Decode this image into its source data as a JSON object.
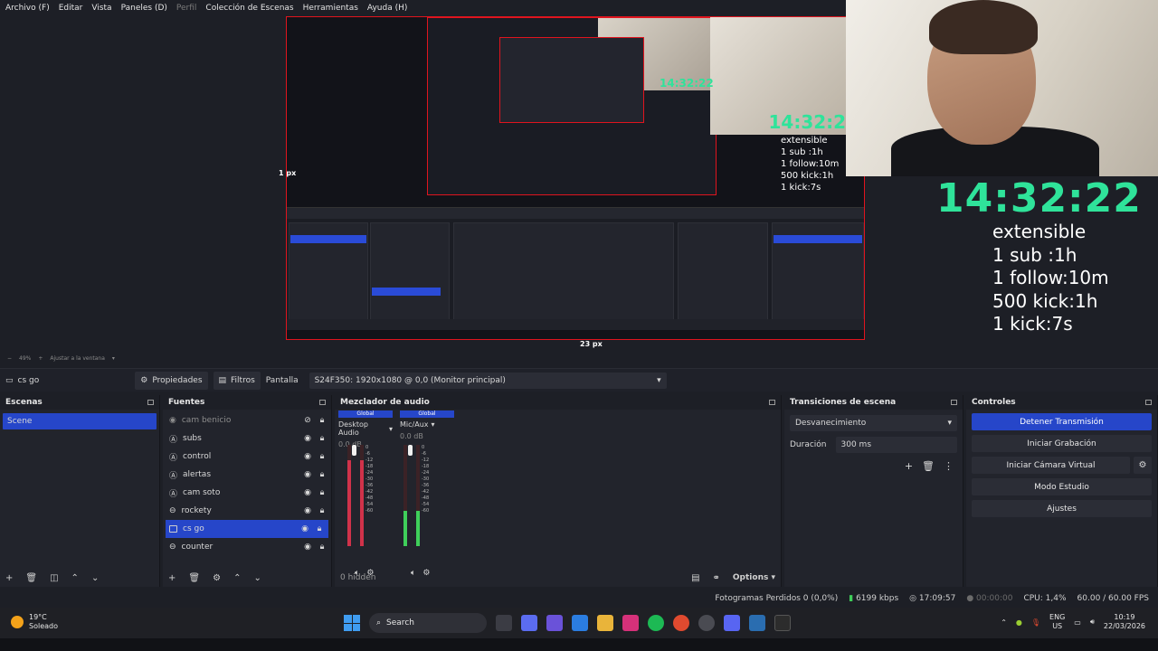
{
  "menu": {
    "items": [
      "Archivo (F)",
      "Editar",
      "Vista",
      "Paneles (D)",
      "Perfil",
      "Colección de Escenas",
      "Herramientas",
      "Ayuda (H)"
    ],
    "disabled_index": 4
  },
  "preview": {
    "px_left": "1 px",
    "px_bottom": "23 px",
    "zoom": "49%",
    "fit_label": "Ajustar a la ventana"
  },
  "overlay": {
    "timer": "14:32:22",
    "rules": [
      "extensible",
      "1 sub :1h",
      "1 follow:10m",
      "500 kick:1h",
      "1 kick:7s"
    ]
  },
  "source_toolbar": {
    "current_source": "cs go",
    "properties": "Propiedades",
    "filters": "Filtros",
    "display_label": "Pantalla",
    "display_value": "S24F350: 1920x1080 @ 0,0 (Monitor principal)"
  },
  "scenes": {
    "title": "Escenas",
    "items": [
      "Scene"
    ]
  },
  "sources": {
    "title": "Fuentes",
    "items": [
      {
        "name": "cam benicio",
        "type": "camera",
        "visible": false
      },
      {
        "name": "subs",
        "type": "text",
        "visible": true
      },
      {
        "name": "control",
        "type": "text",
        "visible": true
      },
      {
        "name": "alertas",
        "type": "text",
        "visible": true
      },
      {
        "name": "cam soto",
        "type": "text",
        "visible": true
      },
      {
        "name": "rockety",
        "type": "link",
        "visible": true
      },
      {
        "name": "cs go",
        "type": "display",
        "visible": true,
        "selected": true
      },
      {
        "name": "counter",
        "type": "link",
        "visible": true
      }
    ]
  },
  "mixer": {
    "title": "Mezclador de audio",
    "global_label": "Global",
    "channels": [
      {
        "name": "Desktop Audio",
        "db": "0.0 dB",
        "level": 0.85,
        "color": "#d0324a"
      },
      {
        "name": "Mic/Aux",
        "db": "0.0 dB",
        "level": 0.35,
        "color": "#3fcf5a"
      }
    ],
    "ticks": [
      "0",
      "-6",
      "-12",
      "-18",
      "-24",
      "-30",
      "-36",
      "-42",
      "-48",
      "-54",
      "-60"
    ],
    "hidden": "0 hidden",
    "options": "Options"
  },
  "transitions": {
    "title": "Transiciones de escena",
    "selected": "Desvanecimiento",
    "duration_label": "Duración",
    "duration_value": "300 ms"
  },
  "controls": {
    "title": "Controles",
    "stop_stream": "Detener Transmisión",
    "start_record": "Iniciar Grabación",
    "virtual_cam": "Iniciar Cámara Virtual",
    "studio_mode": "Modo Estudio",
    "settings": "Ajustes"
  },
  "status": {
    "dropped": "Fotogramas Perdidos 0 (0,0%)",
    "bitrate": "6199 kbps",
    "stream_time": "17:09:57",
    "record_time": "00:00:00",
    "cpu": "CPU: 1,4%",
    "fps": "60.00 / 60.00 FPS"
  },
  "taskbar": {
    "weather_temp": "19°C",
    "weather_desc": "Soleado",
    "search": "Search",
    "lang1": "ENG",
    "lang2": "US",
    "time": "10:19",
    "date": "22/03/2026"
  },
  "colors": {
    "accent": "#2646c9",
    "timer_green": "#2fe39a",
    "red_outline": "#e0141e"
  }
}
